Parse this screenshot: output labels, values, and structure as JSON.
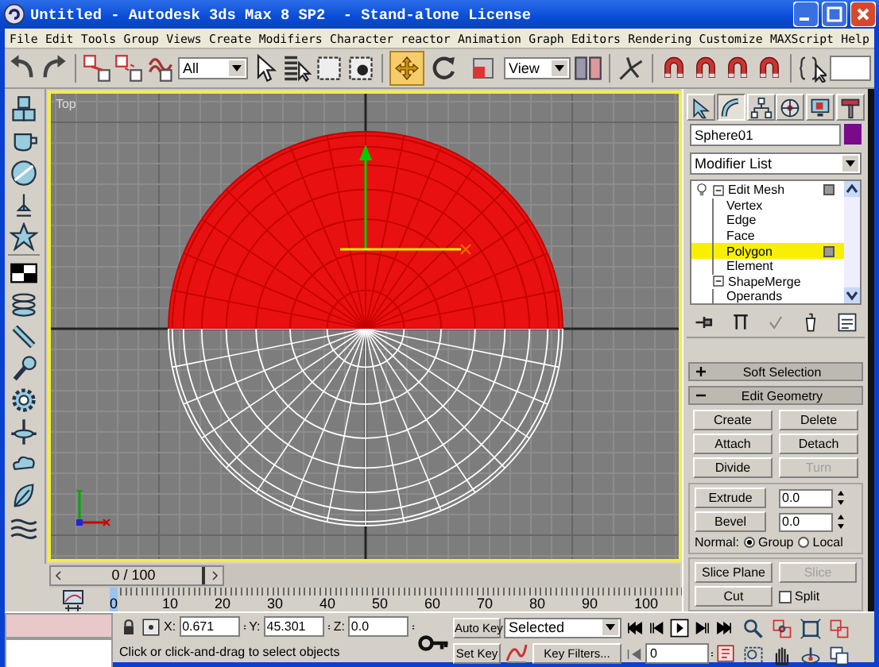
{
  "window": {
    "title": "Untitled - Autodesk 3ds Max 8 SP2  - Stand-alone License"
  },
  "menu": [
    "File",
    "Edit",
    "Tools",
    "Group",
    "Views",
    "Create",
    "Modifiers",
    "Character",
    "reactor",
    "Animation",
    "Graph Editors",
    "Rendering",
    "Customize",
    "MAXScript",
    "Help"
  ],
  "toolbar": {
    "selection_filter": "All",
    "reference_coordinate": "View",
    "transform_tools": [
      {
        "kind": "move",
        "selected": true
      },
      {
        "kind": "rotate",
        "selected": false
      },
      {
        "kind": "scale",
        "selected": false
      }
    ]
  },
  "viewport": {
    "label": "Top",
    "active": true
  },
  "command_panel": {
    "tabs": [
      {
        "kind": "create",
        "selected": false
      },
      {
        "kind": "modify",
        "selected": true
      },
      {
        "kind": "hierarchy",
        "selected": false
      },
      {
        "kind": "motion",
        "selected": false
      },
      {
        "kind": "display",
        "selected": false
      },
      {
        "kind": "utilities",
        "selected": false
      }
    ],
    "object_name": "Sphere01",
    "modifier_list": "Modifier List",
    "stack": [
      {
        "kind": "modifier",
        "label": "Edit Mesh",
        "expanded": true,
        "selected": false,
        "children": [
          {
            "label": "Vertex",
            "selected": false
          },
          {
            "label": "Edge",
            "selected": false
          },
          {
            "label": "Face",
            "selected": false
          },
          {
            "label": "Polygon",
            "selected": true
          },
          {
            "label": "Element",
            "selected": false
          }
        ]
      },
      {
        "kind": "object",
        "label": "ShapeMerge",
        "expanded": true,
        "selected": false,
        "children": [
          {
            "label": "Operands",
            "selected": false
          }
        ]
      }
    ],
    "rollouts": [
      {
        "label": "Soft Selection",
        "expanded": false
      },
      {
        "label": "Edit Geometry",
        "expanded": true
      }
    ],
    "edit_geometry": {
      "buttons": [
        {
          "label": "Create",
          "disabled": false
        },
        {
          "label": "Delete",
          "disabled": false
        },
        {
          "label": "Attach",
          "disabled": false
        },
        {
          "label": "Detach",
          "disabled": false
        },
        {
          "label": "Divide",
          "disabled": false
        },
        {
          "label": "Turn",
          "disabled": true
        }
      ],
      "spinners": [
        {
          "label": "Extrude",
          "value": "0.0"
        },
        {
          "label": "Bevel",
          "value": "0.0"
        }
      ],
      "normal": {
        "label": "Normal:",
        "options": [
          {
            "label": "Group",
            "selected": true
          },
          {
            "label": "Local",
            "selected": false
          }
        ]
      },
      "slice_buttons": [
        {
          "label": "Slice Plane",
          "disabled": false
        },
        {
          "label": "Slice",
          "disabled": true
        }
      ],
      "cut": {
        "label": "Cut",
        "disabled": false
      },
      "split": {
        "label": "Split",
        "checked": false
      }
    }
  },
  "time_slider": {
    "label": "0 / 100"
  },
  "ruler": [
    "0",
    "10",
    "20",
    "30",
    "40",
    "50",
    "60",
    "70",
    "80",
    "90",
    "100"
  ],
  "coordinates": [
    {
      "axis": "X:",
      "value": "0.671"
    },
    {
      "axis": "Y:",
      "value": "45.301"
    },
    {
      "axis": "Z:",
      "value": "0.0"
    }
  ],
  "animation": {
    "auto_key": "Auto Key",
    "key_mode": "Selected",
    "set_key": "Set Key",
    "key_filters": "Key Filters...",
    "frame": "0"
  },
  "prompt": "Click or click-and-drag to select objects"
}
